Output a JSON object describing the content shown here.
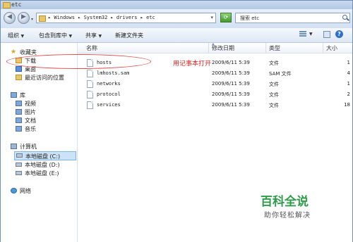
{
  "window": {
    "title": "etc"
  },
  "address": {
    "path": "▸ Windows ▸ System32 ▸ drivers ▸ etc",
    "search_placeholder": "搜索 etc"
  },
  "toolbar": {
    "organize": "组织",
    "include_in_library": "包含到库中",
    "share": "共享",
    "new_folder": "新建文件夹"
  },
  "sidebar": {
    "favorites": {
      "label": "收藏夹",
      "items": [
        "下载",
        "桌面",
        "最近访问的位置"
      ]
    },
    "libraries": {
      "label": "库",
      "items": [
        "视频",
        "图片",
        "文档",
        "音乐"
      ]
    },
    "computer": {
      "label": "计算机",
      "items": [
        "本地磁盘 (C:)",
        "本地磁盘 (D:)",
        "本地磁盘 (E:)"
      ]
    },
    "network": {
      "label": "网络"
    }
  },
  "columns": {
    "name": "名称",
    "date": "修改日期",
    "type": "类型",
    "size": "大小"
  },
  "files": [
    {
      "name": "hosts",
      "date": "2009/6/11 5:39",
      "type": "文件",
      "size": "1"
    },
    {
      "name": "lmhosts.sam",
      "date": "2009/6/11 5:39",
      "type": "SAM 文件",
      "size": "4"
    },
    {
      "name": "networks",
      "date": "2009/6/11 5:39",
      "type": "文件",
      "size": "1"
    },
    {
      "name": "protocol",
      "date": "2009/6/11 5:39",
      "type": "文件",
      "size": "2"
    },
    {
      "name": "services",
      "date": "2009/6/11 5:39",
      "type": "文件",
      "size": "18"
    }
  ],
  "annotation": "用记事本打开",
  "watermark": {
    "title": "百科全说",
    "subtitle": "助你轻松解决"
  }
}
